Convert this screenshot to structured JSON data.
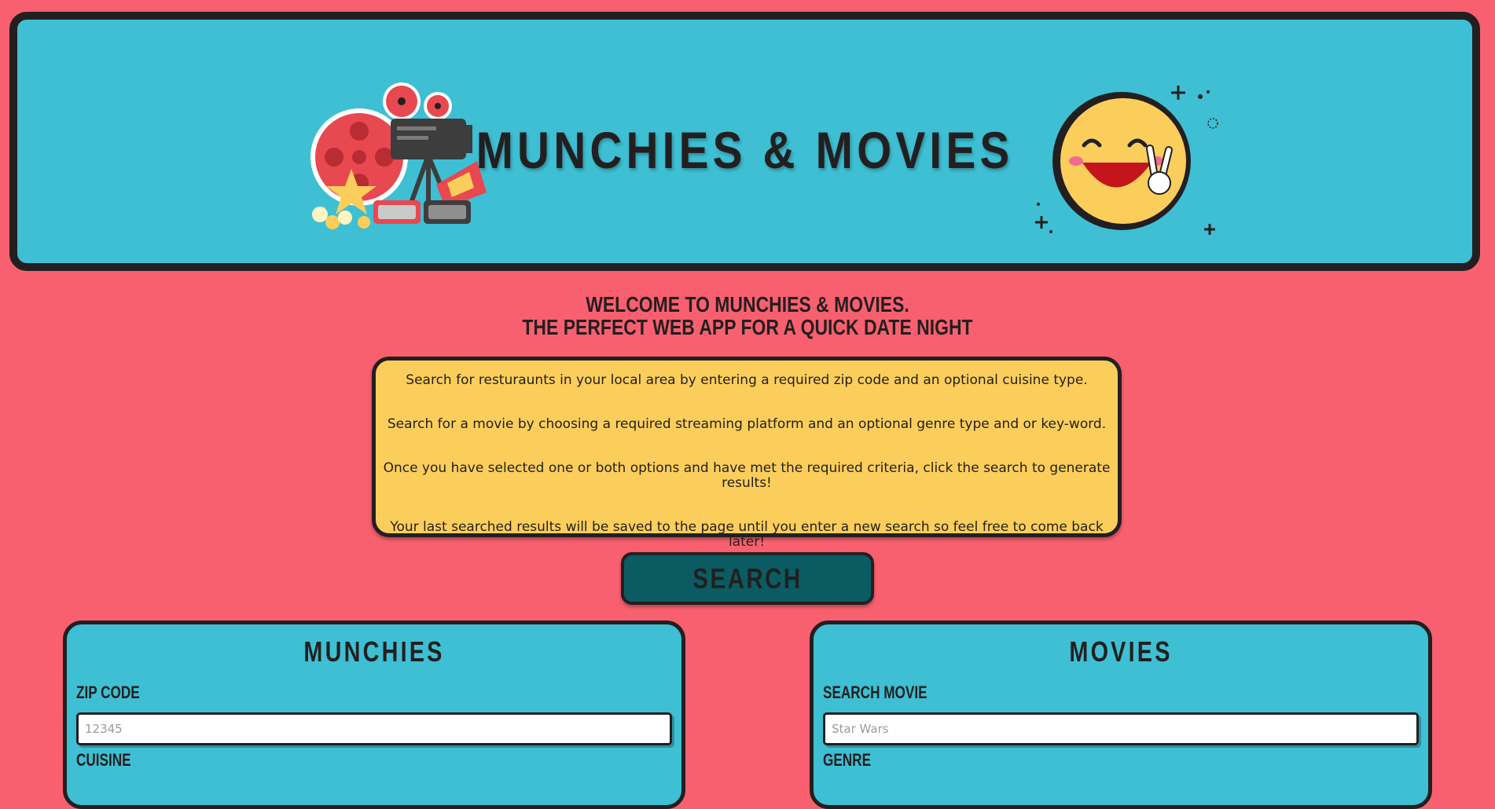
{
  "header": {
    "title": "MUNCHIES & MOVIES",
    "left_icon": "film-projector-icon",
    "right_icon": "laughing-emoji-icon"
  },
  "welcome": {
    "line1": "WELCOME TO MUNCHIES & MOVIES.",
    "line2": "THE PERFECT WEB APP FOR A QUICK DATE NIGHT"
  },
  "instructions": [
    "Search for resturaunts in your local area by entering a required zip code and an optional cuisine type.",
    "Search for a movie by choosing a required streaming platform and an optional genre type and or key-word.",
    "Once you have selected one or both options and have met the required criteria, click the search to generate results!",
    "Your last searched results will be saved to the page until you enter a new search so feel free to come back later!"
  ],
  "search_button": "SEARCH",
  "munchies": {
    "title": "MUNCHIES",
    "zip_label": "ZIP CODE",
    "zip_placeholder": "12345",
    "cuisine_label": "CUISINE"
  },
  "movies": {
    "title": "MOVIES",
    "search_label": "SEARCH MOVIE",
    "search_placeholder": "Star Wars",
    "genre_label": "GENRE"
  },
  "colors": {
    "background": "#f9606f",
    "header_bg": "#3ebfd3",
    "instructions_bg": "#fbce5b",
    "button_bg": "#0b5c62",
    "outline": "#231f20"
  }
}
